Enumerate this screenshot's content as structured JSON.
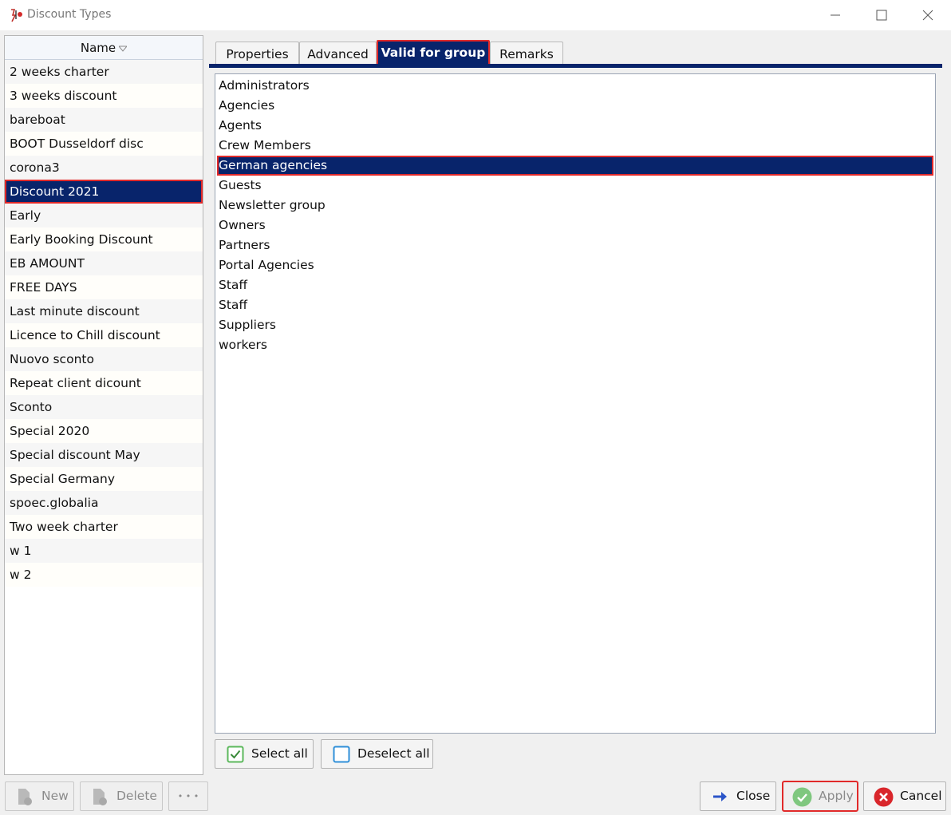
{
  "window": {
    "title": "Discount Types",
    "minimize_icon": "minimize-icon",
    "maximize_icon": "maximize-icon",
    "close_icon": "close-icon"
  },
  "discount_list": {
    "column_header": "Name",
    "sort_icon": "sort-descending-icon",
    "items": [
      "2 weeks charter",
      "3 weeks discount",
      "bareboat",
      "BOOT Dusseldorf disc",
      "corona3",
      "Discount 2021",
      "Early",
      "Early Booking Discount",
      "EB AMOUNT",
      "FREE DAYS",
      "Last minute discount",
      "Licence to Chill discount",
      "Nuovo sconto",
      "Repeat client dicount",
      "Sconto",
      "Special 2020",
      "Special discount May",
      "Special Germany",
      "spoec.globalia",
      "Two week charter",
      "w 1",
      "w 2"
    ],
    "selected": "Discount 2021"
  },
  "tabs": [
    {
      "label": "Properties"
    },
    {
      "label": "Advanced"
    },
    {
      "label": "Valid for group"
    },
    {
      "label": "Remarks"
    }
  ],
  "active_tab": "Valid for group",
  "groups": {
    "items": [
      "Administrators",
      "Agencies",
      "Agents",
      "Crew Members",
      "German agencies",
      "Guests",
      "Newsletter group",
      "Owners",
      "Partners",
      "Portal Agencies",
      "Staff",
      "Staff",
      "Suppliers",
      "workers"
    ],
    "selected": "German agencies"
  },
  "selection_buttons": {
    "select_all": "Select all",
    "deselect_all": "Deselect all"
  },
  "footer": {
    "new_label": "New",
    "delete_label": "Delete",
    "more_label": "• • •",
    "close_label": "Close",
    "apply_label": "Apply",
    "cancel_label": "Cancel"
  },
  "colors": {
    "selection": "#08246b",
    "highlight_border": "#e12a2a",
    "apply_green": "#5cb85c",
    "cancel_red": "#d9262b",
    "close_blue": "#2b55c8"
  }
}
